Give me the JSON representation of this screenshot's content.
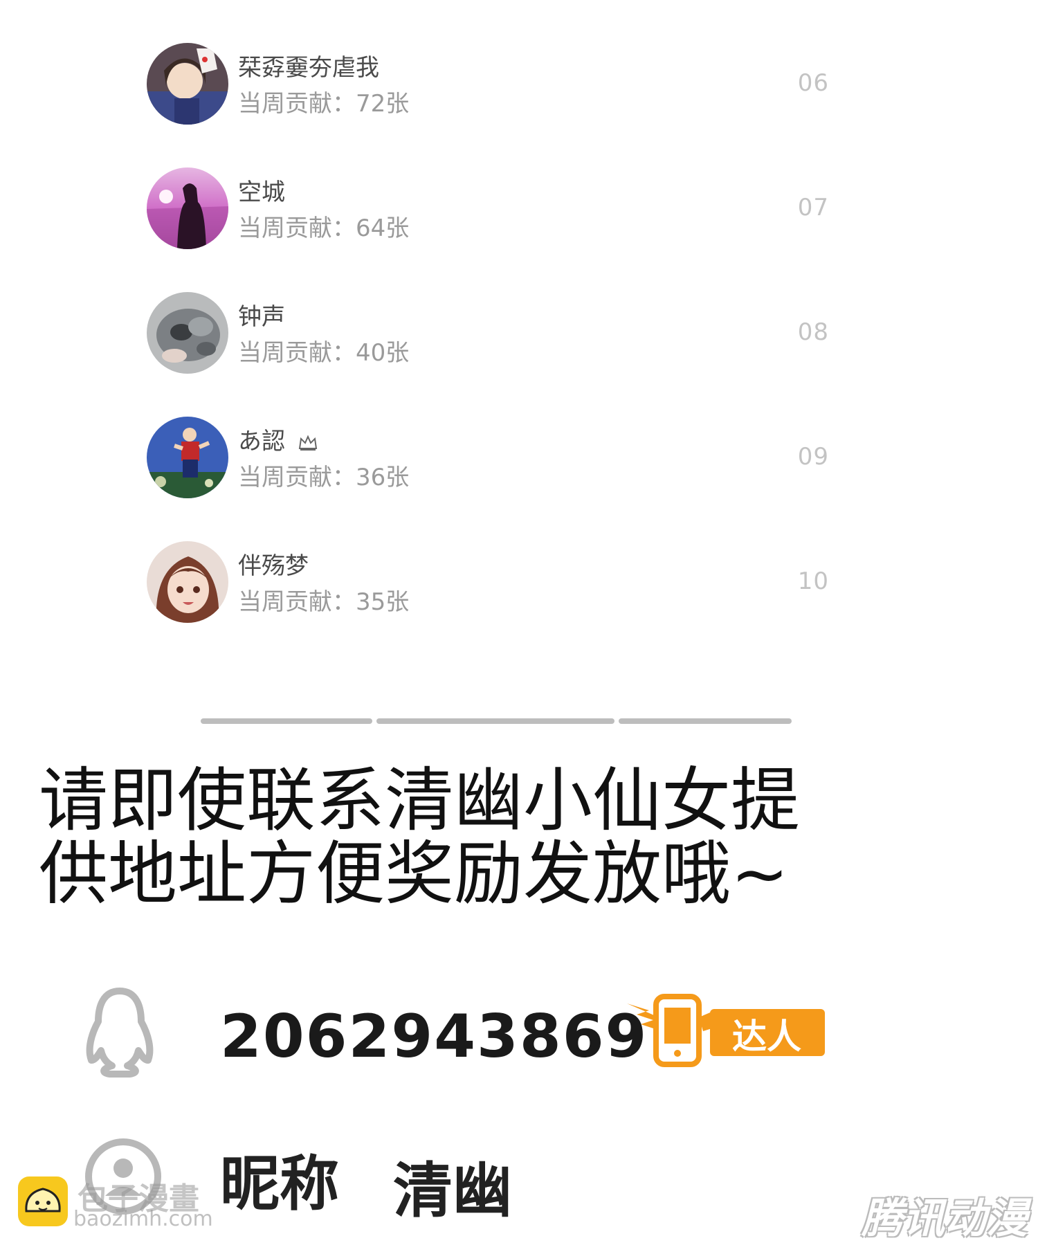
{
  "leaderboard": {
    "contrib_label": "当周贡献：",
    "rows": [
      {
        "name": "栞孬嫑夯虐我",
        "count": "72张",
        "rank": "06",
        "avatar": "anime-woman-with-fox-mask-avatar"
      },
      {
        "name": "空城",
        "count": "64张",
        "rank": "07",
        "avatar": "pink-sunset-silhouette-avatar"
      },
      {
        "name": "钟声",
        "count": "40张",
        "rank": "08",
        "avatar": "gray-cat-avatar"
      },
      {
        "name": "あ認",
        "count": "36张",
        "rank": "09",
        "avatar": "running-boy-blue-sky-avatar",
        "badge_icon": "crown-icon"
      },
      {
        "name": "伴殇梦",
        "count": "35张",
        "rank": "10",
        "avatar": "anime-girl-brown-hair-avatar"
      }
    ]
  },
  "notice": {
    "line1": "请即使联系清幽小仙女提",
    "line2": "供地址方便奖励发放哦~"
  },
  "contact": {
    "qq_number": "2062943869",
    "badge_label": "达人",
    "nickname_label": "昵称",
    "nickname_value": "清幽"
  },
  "watermarks": {
    "left_title": "包子漫畫",
    "left_url": "baozimh.com",
    "right_title": "腾讯动漫"
  },
  "colors": {
    "badge_orange": "#f59a1a",
    "name_text": "#4a4a4a",
    "sub_text": "#9a9a9a",
    "rank_text": "#c3c3c3"
  }
}
